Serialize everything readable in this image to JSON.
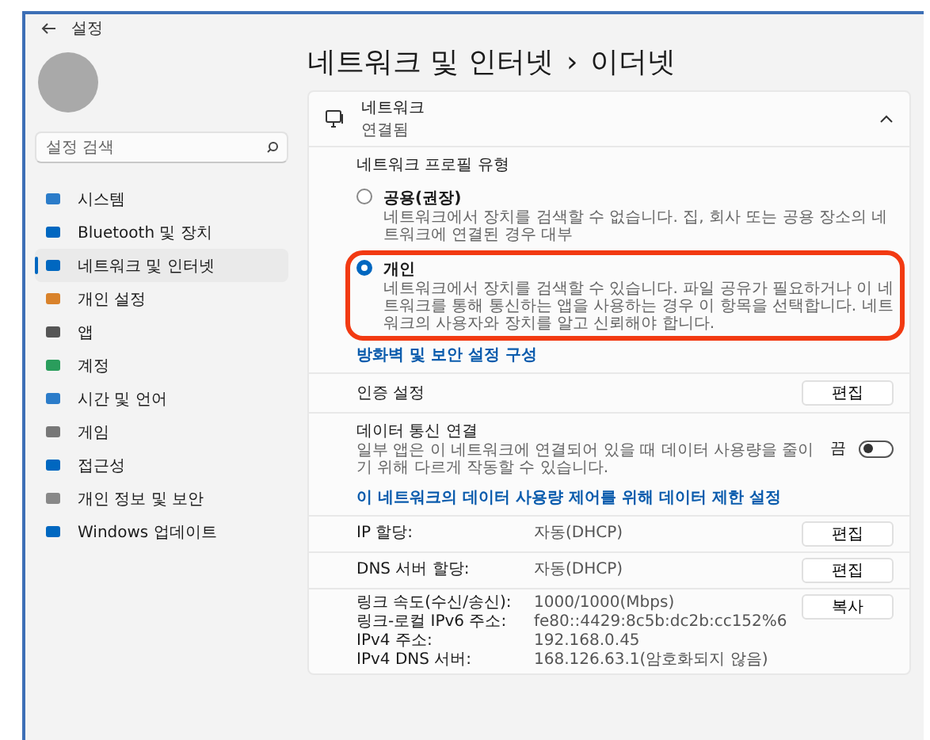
{
  "window": {
    "title": "설정"
  },
  "sidebar": {
    "search": {
      "placeholder": "설정 검색"
    },
    "items": [
      {
        "label": "시스템",
        "selected": false
      },
      {
        "label": "Bluetooth 및 장치",
        "selected": false
      },
      {
        "label": "네트워크 및 인터넷",
        "selected": true
      },
      {
        "label": "개인 설정",
        "selected": false
      },
      {
        "label": "앱",
        "selected": false
      },
      {
        "label": "계정",
        "selected": false
      },
      {
        "label": "시간 및 언어",
        "selected": false
      },
      {
        "label": "게임",
        "selected": false
      },
      {
        "label": "접근성",
        "selected": false
      },
      {
        "label": "개인 정보 및 보안",
        "selected": false
      },
      {
        "label": "Windows 업데이트",
        "selected": false
      }
    ]
  },
  "breadcrumb": {
    "parent": "네트워크 및 인터넷",
    "separator": "›",
    "current": "이더넷"
  },
  "network_card": {
    "title": "네트워크",
    "status": "연결됨",
    "expanded": true
  },
  "profile": {
    "heading": "네트워크 프로필 유형",
    "options": [
      {
        "label": "공용(권장)",
        "description": "네트워크에서 장치를 검색할 수 없습니다. 집, 회사 또는 공용 장소의 네트워크에 연결된 경우 대부",
        "selected": false,
        "highlighted": false
      },
      {
        "label": "개인",
        "description": "네트워크에서 장치를 검색할 수 있습니다. 파일 공유가 필요하거나 이 네트워크를 통해 통신하는 앱을 사용하는 경우 이 항목을 선택합니다. 네트워크의 사용자와 장치를 알고 신뢰해야 합니다.",
        "selected": true,
        "highlighted": true
      }
    ],
    "link": "방화벽 및 보안 설정 구성"
  },
  "auth": {
    "label": "인증 설정",
    "button": "편집"
  },
  "metered": {
    "title": "데이터 통신 연결",
    "description": "일부 앱은 이 네트워크에 연결되어 있을 때 데이터 사용량을 줄이기 위해 다르게 작동할 수 있습니다.",
    "toggle_label": "끔",
    "on": false,
    "link": "이 네트워크의 데이터 사용량 제어를 위해 데이터 제한 설정"
  },
  "ip_rows": [
    {
      "label": "IP 할당:",
      "value": "자동(DHCP)",
      "button": "편집"
    },
    {
      "label": "DNS 서버 할당:",
      "value": "자동(DHCP)",
      "button": "편집"
    }
  ],
  "details": {
    "button": "복사",
    "rows": [
      {
        "label": "링크 속도(수신/송신):",
        "value": "1000/1000(Mbps)"
      },
      {
        "label": "링크-로컬 IPv6 주소:",
        "value": "fe80::4429:8c5b:dc2b:cc152%6"
      },
      {
        "label": "IPv4 주소:",
        "value": "192.168.0.45"
      },
      {
        "label": "IPv4 DNS 서버:",
        "value": "168.126.63.1(암호화되지 않음)"
      }
    ]
  }
}
